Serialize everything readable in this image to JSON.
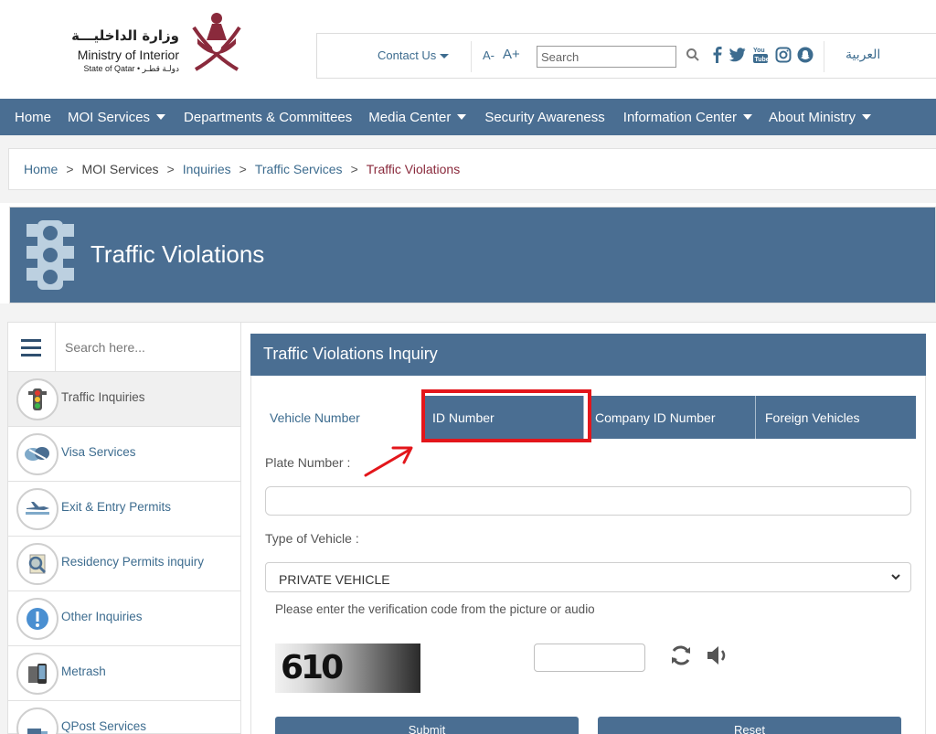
{
  "logo": {
    "arabic_name": "وزارة الداخليـــة",
    "english_name": "Ministry of Interior",
    "subtitle": "State of Qatar • دولـة قطـر"
  },
  "topbar": {
    "contact_label": "Contact Us",
    "font_decrease": "A-",
    "font_increase": "A+",
    "search_placeholder": "Search",
    "social_icons": [
      "facebook-icon",
      "twitter-icon",
      "youtube-icon",
      "instagram-icon",
      "snapchat-icon"
    ],
    "language_link": "العربية"
  },
  "nav": {
    "items": [
      {
        "label": "Home",
        "dropdown": false
      },
      {
        "label": "MOI Services",
        "dropdown": true
      },
      {
        "label": "Departments & Committees",
        "dropdown": false
      },
      {
        "label": "Media Center",
        "dropdown": true
      },
      {
        "label": "Security Awareness",
        "dropdown": false
      },
      {
        "label": "Information Center",
        "dropdown": true
      },
      {
        "label": "About Ministry",
        "dropdown": true
      }
    ]
  },
  "breadcrumb": {
    "items": [
      "Home",
      "MOI Services",
      "Inquiries",
      "Traffic Services"
    ],
    "current": "Traffic Violations",
    "separator": ">"
  },
  "banner": {
    "title": "Traffic Violations"
  },
  "sidebar": {
    "search_placeholder": "Search here...",
    "items": [
      {
        "label": "Traffic Inquiries",
        "active": true
      },
      {
        "label": "Visa Services",
        "active": false
      },
      {
        "label": "Exit & Entry Permits",
        "active": false
      },
      {
        "label": "Residency Permits inquiry",
        "active": false
      },
      {
        "label": "Other Inquiries",
        "active": false
      },
      {
        "label": "Metrash",
        "active": false
      },
      {
        "label": "QPost Services",
        "active": false
      }
    ]
  },
  "form": {
    "title": "Traffic Violations Inquiry",
    "tabs": [
      {
        "label": "Vehicle Number"
      },
      {
        "label": "ID Number",
        "highlighted": true
      },
      {
        "label": "Company ID Number"
      },
      {
        "label": "Foreign Vehicles"
      }
    ],
    "plate_label": "Plate Number :",
    "plate_value": "",
    "vehicle_type_label": "Type of Vehicle :",
    "vehicle_type_value": "PRIVATE VEHICLE",
    "captcha_hint": "Please enter the verification code from the picture or audio",
    "captcha_code": "610",
    "captcha_value": "",
    "submit_label": "Submit",
    "reset_label": "Reset"
  },
  "colors": {
    "brand_blue": "#4a6e92",
    "link_blue": "#3d6c8f",
    "maroon": "#8a2a3c",
    "highlight_red": "#e3161b"
  }
}
